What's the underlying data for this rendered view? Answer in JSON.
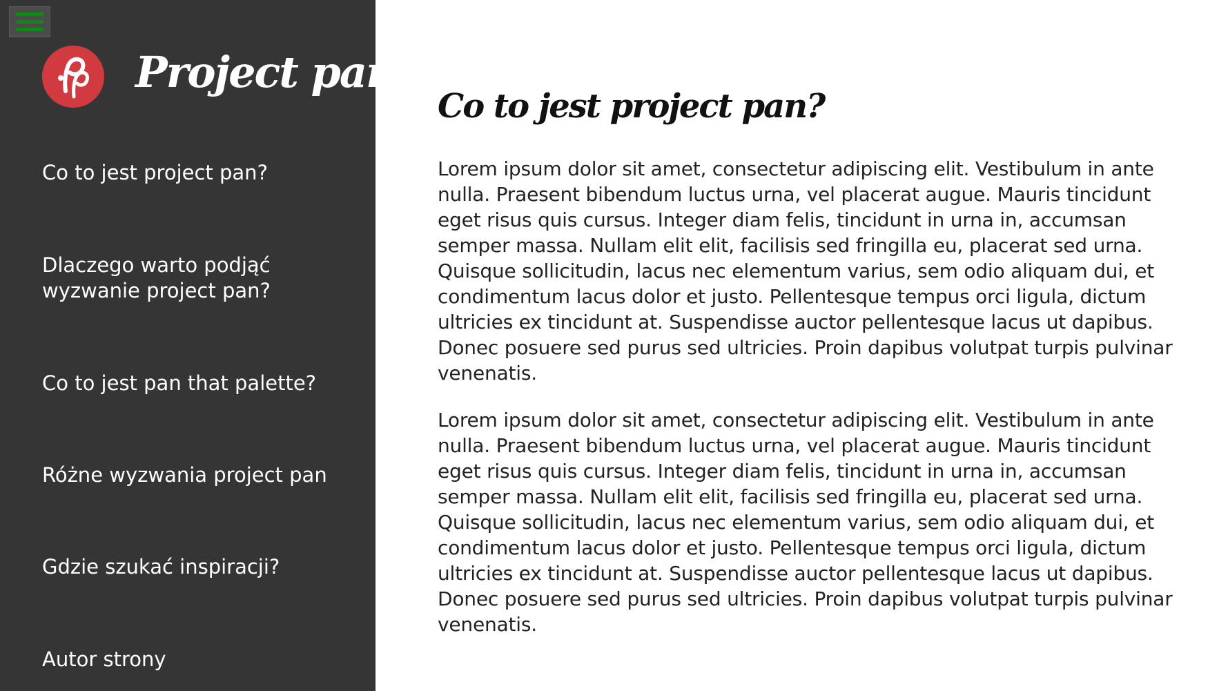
{
  "sidebar": {
    "menu_icon": "hamburger-menu-icon",
    "logo_icon": "pp-logo-icon",
    "brand": "Project pan",
    "items": [
      {
        "label": "Co to jest project pan?"
      },
      {
        "label": "Dlaczego warto podjąć wyzwanie project pan?"
      },
      {
        "label": "Co to jest pan that palette?"
      },
      {
        "label": "Różne wyzwania project pan"
      },
      {
        "label": "Gdzie szukać inspiracji?"
      },
      {
        "label": "Autor strony"
      }
    ]
  },
  "main": {
    "title": "Co to jest project pan?",
    "paragraphs": [
      "Lorem ipsum dolor sit amet, consectetur adipiscing elit. Vestibulum in ante nulla. Praesent bibendum luctus urna, vel placerat augue. Mauris tincidunt eget risus quis cursus. Integer diam felis, tincidunt in urna in, accumsan semper massa. Nullam elit elit, facilisis sed fringilla eu, placerat sed urna. Quisque sollicitudin, lacus nec elementum varius, sem odio aliquam dui, et condimentum lacus dolor et justo. Pellentesque tempus orci ligula, dictum ultricies ex tincidunt at. Suspendisse auctor pellentesque lacus ut dapibus. Donec posuere sed purus sed ultricies. Proin dapibus volutpat turpis pulvinar venenatis.",
      "Lorem ipsum dolor sit amet, consectetur adipiscing elit. Vestibulum in ante nulla. Praesent bibendum luctus urna, vel placerat augue. Mauris tincidunt eget risus quis cursus. Integer diam felis, tincidunt in urna in, accumsan semper massa. Nullam elit elit, facilisis sed fringilla eu, placerat sed urna. Quisque sollicitudin, lacus nec elementum varius, sem odio aliquam dui, et condimentum lacus dolor et justo. Pellentesque tempus orci ligula, dictum ultricies ex tincidunt at. Suspendisse auctor pellentesque lacus ut dapibus. Donec posuere sed purus sed ultricies. Proin dapibus volutpat turpis pulvinar venenatis."
    ]
  },
  "colors": {
    "sidebar_bg": "#353535",
    "menu_icon": "#0f8a14",
    "logo_bg": "#d13b40",
    "text_dark": "#222222",
    "text_light": "#ffffff"
  }
}
